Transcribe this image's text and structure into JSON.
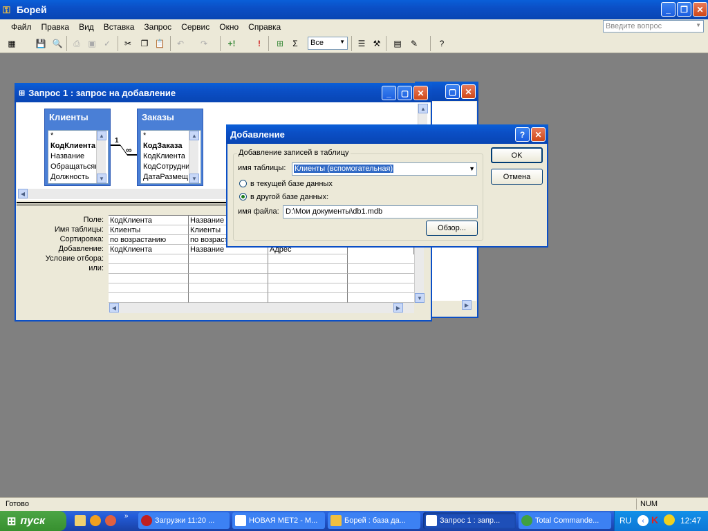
{
  "app": {
    "title": "Борей"
  },
  "menu": [
    "Файл",
    "Правка",
    "Вид",
    "Вставка",
    "Запрос",
    "Сервис",
    "Окно",
    "Справка"
  ],
  "help_placeholder": "Введите вопрос",
  "toolbar": {
    "combo_value": "Все"
  },
  "query_window": {
    "title": "Запрос 1 : запрос на добавление",
    "table1": {
      "name": "Клиенты",
      "fields": [
        "*",
        "КодКлиента",
        "Название",
        "Обращатьсяк",
        "Должность"
      ]
    },
    "table2": {
      "name": "Заказы",
      "fields": [
        "*",
        "КодЗаказа",
        "КодКлиента",
        "КодСотрудни",
        "ДатаРазмещ"
      ]
    },
    "relation": {
      "one": "1",
      "many": "∞"
    },
    "grid_labels": [
      "Поле:",
      "Имя таблицы:",
      "Сортировка:",
      "Добавление:",
      "Условие отбора:",
      "или:"
    ],
    "col1": [
      "КодКлиента",
      "Клиенты",
      "по возрастанию",
      "КодКлиента"
    ],
    "col2": [
      "Название",
      "Клиенты",
      "по возраст",
      "Название"
    ],
    "col3": [
      "",
      "",
      "",
      "Адрес"
    ]
  },
  "dialog": {
    "title": "Добавление",
    "group_label": "Добавление записей в таблицу",
    "table_name_label": "имя таблицы:",
    "table_name_value": "Клиенты (вспомогательная)",
    "radio_current": "в текущей базе данных",
    "radio_other": "в другой базе данных:",
    "file_label": "имя файла:",
    "file_value": "D:\\Мои документы\\db1.mdb",
    "browse": "Обзор...",
    "ok": "OK",
    "cancel": "Отмена"
  },
  "statusbar": {
    "left": "Готово",
    "num": "NUM"
  },
  "taskbar": {
    "start": "пуск",
    "buttons": [
      "Загрузки 11:20 ...",
      "НОВАЯ МЕТ2 - М...",
      "Борей : база да...",
      "Запрос 1 : запр...",
      "Total Commande..."
    ],
    "lang": "RU",
    "clock": "12:47"
  }
}
